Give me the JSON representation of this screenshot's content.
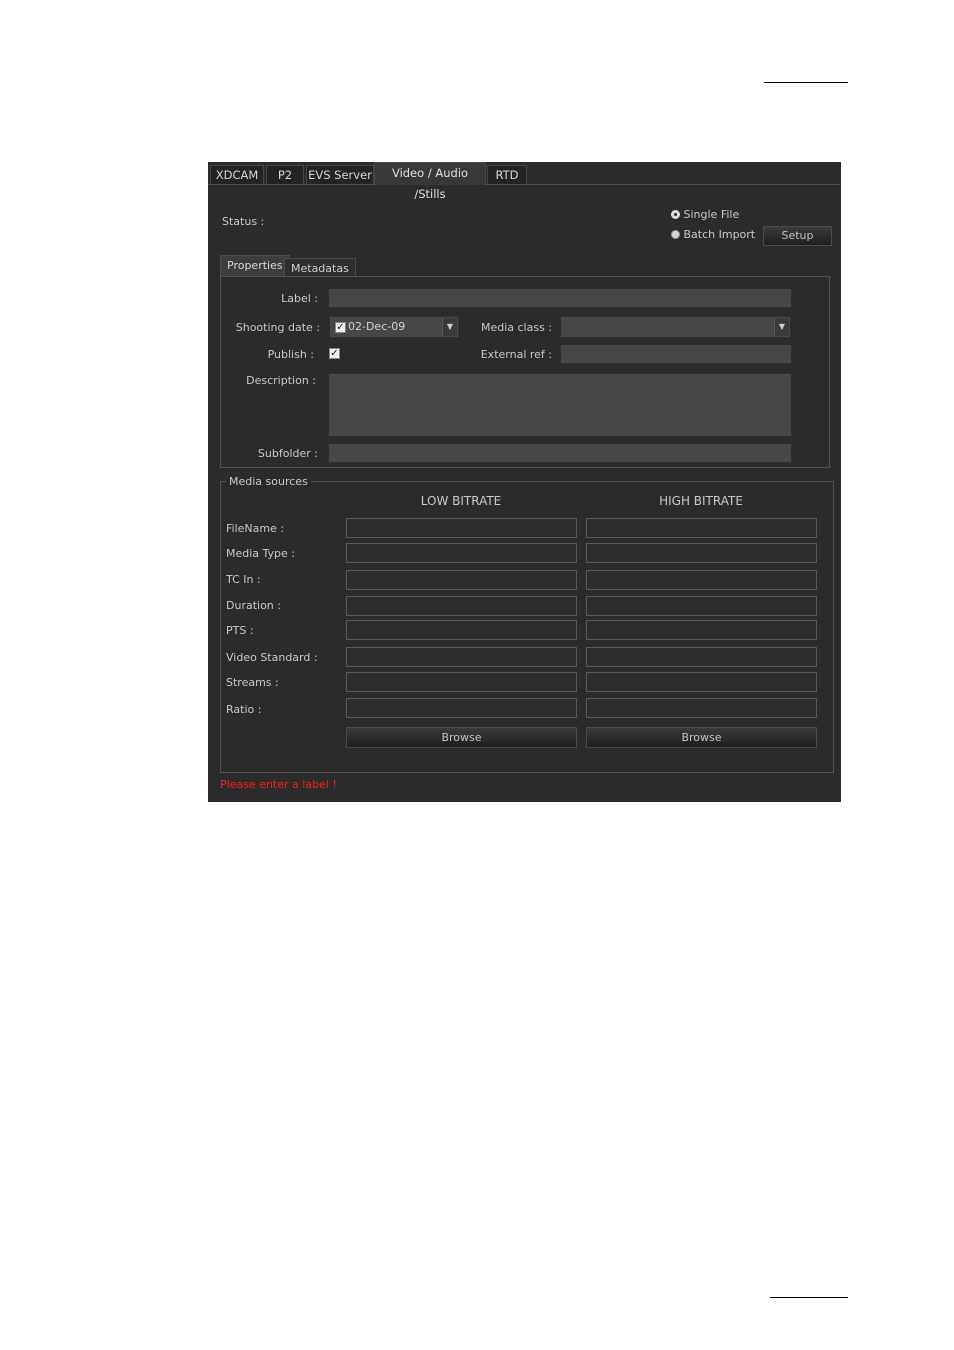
{
  "tabs": [
    {
      "label": "XDCAM",
      "active": false
    },
    {
      "label": "P2",
      "active": false
    },
    {
      "label": "EVS Server",
      "active": false
    },
    {
      "label": "Video / Audio /Stills",
      "active": true
    },
    {
      "label": "RTD",
      "active": false
    }
  ],
  "status_label": "Status :",
  "mode": {
    "single_file": "Single File",
    "batch_import": "Batch Import",
    "selected": "single_file"
  },
  "setup_label": "Setup",
  "subtabs": [
    {
      "label": "Properties",
      "active": true
    },
    {
      "label": "Metadatas",
      "active": false
    }
  ],
  "properties": {
    "label_label": "Label :",
    "label_value": "",
    "shooting_date_label": "Shooting date :",
    "shooting_date_value": "02-Dec-09",
    "media_class_label": "Media class :",
    "media_class_value": "",
    "publish_label": "Publish :",
    "publish_checked": true,
    "external_ref_label": "External ref :",
    "external_ref_value": "",
    "description_label": "Description :",
    "description_value": "",
    "subfolder_label": "Subfolder :",
    "subfolder_value": ""
  },
  "media_sources": {
    "title": "Media sources",
    "low_bitrate": "LOW BITRATE",
    "high_bitrate": "HIGH BITRATE",
    "rows": [
      {
        "label": "FileName :",
        "low": "",
        "high": ""
      },
      {
        "label": "Media Type :",
        "low": "",
        "high": ""
      },
      {
        "label": "TC In :",
        "low": "",
        "high": ""
      },
      {
        "label": "Duration :",
        "low": "",
        "high": ""
      },
      {
        "label": "PTS :",
        "low": "",
        "high": ""
      },
      {
        "label": "Video Standard :",
        "low": "",
        "high": ""
      },
      {
        "label": "Streams :",
        "low": "",
        "high": ""
      },
      {
        "label": "Ratio :",
        "low": "",
        "high": ""
      }
    ],
    "browse_low": "Browse",
    "browse_high": "Browse"
  },
  "error_message": "Please enter a label !"
}
